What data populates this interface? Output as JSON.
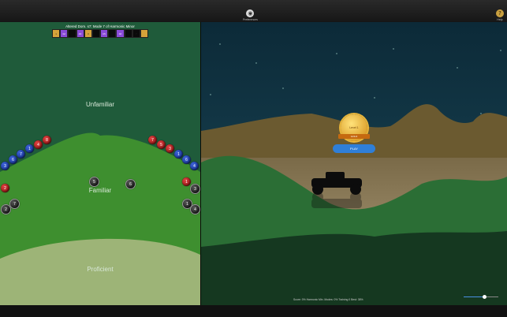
{
  "toolbar": {
    "preferences_label": "Preferences",
    "help_label": "Help",
    "help_glyph": "?",
    "preferences_icon": "preferences-icon",
    "help_icon": "help-icon"
  },
  "left_panel": {
    "mode_title": "Altered Dom. s7: Mode 7 of Harmonic Minor",
    "keys": [
      "1",
      "b2",
      "",
      "#2",
      "3",
      "",
      "b5",
      "",
      "b6",
      "",
      "7",
      ""
    ],
    "zones": {
      "unfamiliar": "Unfamiliar",
      "familiar": "Familiar",
      "proficient": "Proficient"
    },
    "balls_left": [
      "8",
      "4",
      "1",
      "7",
      "6",
      "3",
      "2",
      "7",
      "2"
    ],
    "balls_center": [
      "5",
      "6"
    ],
    "balls_right": [
      "7",
      "5",
      "3",
      "1",
      "6",
      "4",
      "1",
      "3",
      "1",
      "4"
    ]
  },
  "right_panel": {
    "badge_text": "Level 1",
    "ribbon_text": "GOLD",
    "play_label": "PLAY",
    "status_text": "Score: 0%  Harmonic Min. Modes: 0%  Training 0  Best: 38%",
    "slider": {
      "value": 0.6
    }
  },
  "colors": {
    "accent_blue": "#2f7fd8",
    "felt": "#1f5b3a",
    "gold": "#d6a33a",
    "purple": "#8a4bd8"
  }
}
